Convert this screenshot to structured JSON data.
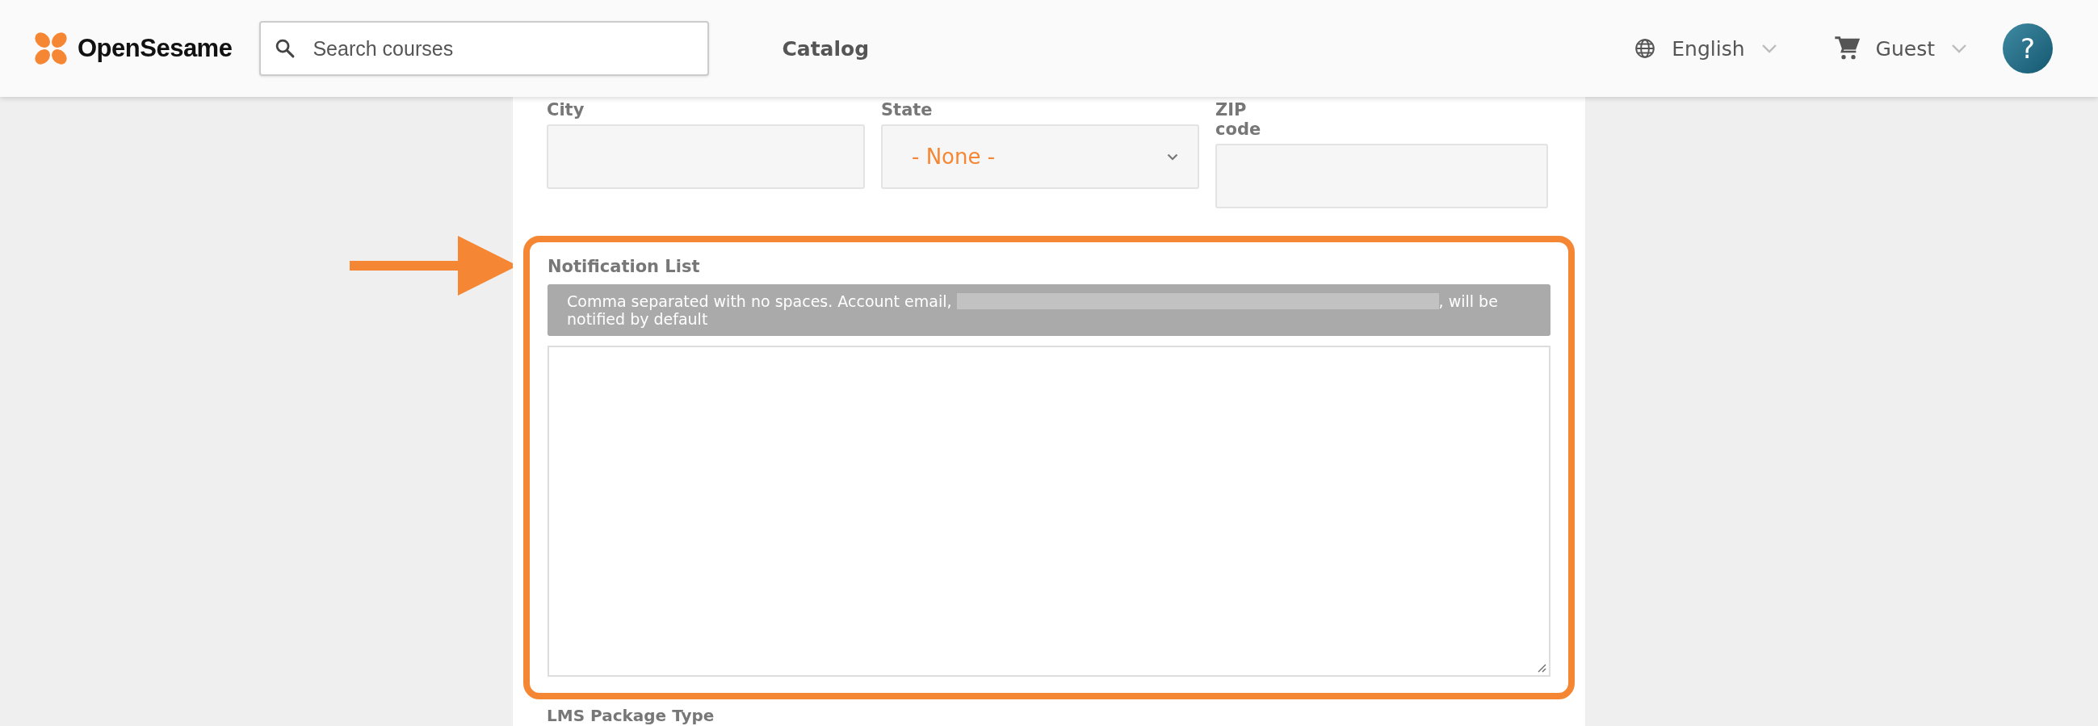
{
  "header": {
    "logo": "OpenSesame",
    "search": {
      "placeholder": "Search courses"
    },
    "nav": [
      {
        "label": "Catalog"
      }
    ],
    "language": "English",
    "user": "Guest",
    "help": "?"
  },
  "form": {
    "fields": [
      {
        "kind": "input",
        "label": "City"
      },
      {
        "kind": "select",
        "label": "State",
        "value": "- None -"
      },
      {
        "kind": "input",
        "label": "ZIP code"
      }
    ],
    "notification": {
      "label": "Notification List",
      "hint_start": "Comma separated with no spaces. Account email,",
      "hint_end": ", will be notified by default",
      "highlighted": true
    },
    "next_label": "LMS Package Type"
  }
}
